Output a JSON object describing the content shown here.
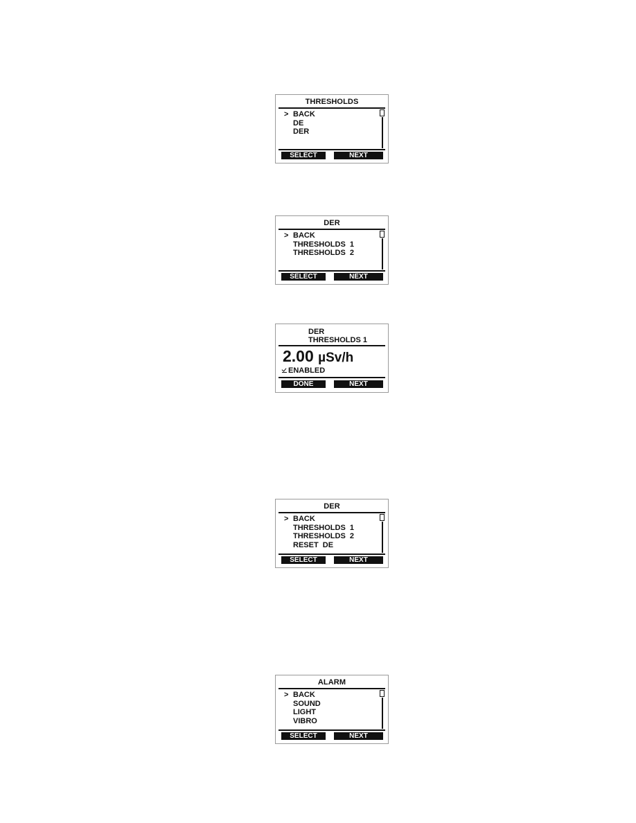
{
  "screens": [
    {
      "title": "THRESHOLDS",
      "cursor": ">",
      "items": [
        "BACK",
        "DE",
        "DER"
      ],
      "buttons": {
        "left": "SELECT",
        "right": "NEXT"
      }
    },
    {
      "title": "DER",
      "cursor": ">",
      "items": [
        "BACK",
        "THRESHOLDS  1",
        "THRESHOLDS  2"
      ],
      "buttons": {
        "left": "SELECT",
        "right": "NEXT"
      }
    },
    {
      "header_line1": "DER",
      "header_line2": "THRESHOLDS 1",
      "value": "2.00",
      "unit": "µSv/h",
      "checkbox_label": "ENABLED",
      "checkbox_checked": true,
      "buttons": {
        "left": "DONE",
        "right": "NEXT"
      }
    },
    {
      "title": "DER",
      "cursor": ">",
      "items": [
        "BACK",
        "THRESHOLDS  1",
        "THRESHOLDS  2",
        "RESET  DE"
      ],
      "buttons": {
        "left": "SELECT",
        "right": "NEXT"
      }
    },
    {
      "title": "ALARM",
      "cursor": ">",
      "items": [
        "BACK",
        "SOUND",
        "LIGHT",
        "VIBRO"
      ],
      "buttons": {
        "left": "SELECT",
        "right": "NEXT"
      }
    }
  ]
}
